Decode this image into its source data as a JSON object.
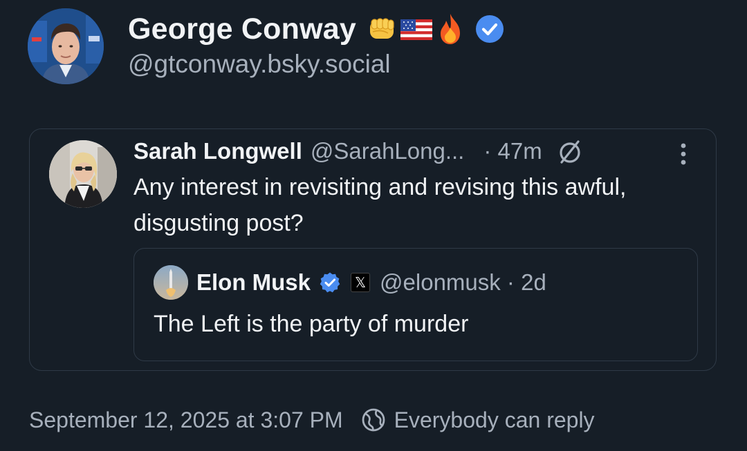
{
  "post": {
    "author": {
      "display_name": "George Conway",
      "emojis": [
        "fist-icon",
        "us-flag-icon",
        "fire-icon"
      ],
      "handle": "@gtconway.bsky.social",
      "verified": true
    },
    "quoted_post": {
      "author_name": "Sarah Longwell",
      "author_handle": "@SarahLong...",
      "time": "· 47m",
      "text": "Any interest in revisiting and revising this awful, disgusting post?",
      "nested_quote": {
        "author_name": "Elon Musk",
        "x_badge": "𝕏",
        "author_handle": "@elonmusk · 2d",
        "text": "The Left is the party of murder"
      }
    },
    "timestamp": "September 12, 2025 at 3:07 PM",
    "reply_setting": "Everybody can reply"
  },
  "colors": {
    "background": "#161e27",
    "text_primary": "#f1f3f5",
    "text_secondary": "#a7b0bc",
    "border": "#2f3a47",
    "verified_blue": "#4a8cf0"
  }
}
